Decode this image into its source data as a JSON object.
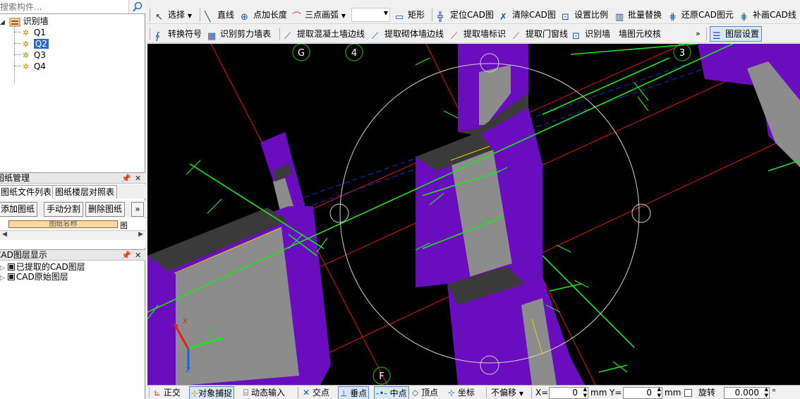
{
  "search": {
    "placeholder": "搜索构件..."
  },
  "tree": {
    "root": "识别墙",
    "items": [
      "Q1",
      "Q2",
      "Q3",
      "Q4"
    ],
    "selected": "Q2"
  },
  "drawing_panel": {
    "title": "图纸管理",
    "tabs": [
      "图纸文件列表",
      "图纸楼层对照表"
    ],
    "buttons": [
      "添加图纸",
      "手动分割",
      "删除图纸"
    ],
    "more": "»",
    "grid_header": "图纸名称",
    "grid_header2": "图"
  },
  "layer_panel": {
    "title": "CAD图层显示",
    "items": [
      "已提取的CAD图层",
      "CAD原始图层"
    ]
  },
  "toolbar1": {
    "select": "选择",
    "line": "直线",
    "point_length": "点加长度",
    "arc": "三点画弧",
    "rect": "矩形",
    "locate_cad": "定位CAD图",
    "clear_cad": "清除CAD图",
    "set_scale": "设置比例",
    "batch_replace": "批量替换",
    "restore_cad": "还原CAD图元",
    "fill_cad": "补画CAD线"
  },
  "toolbar2": {
    "convert_symbol": "转换符号",
    "shear_wall_table": "识别剪力墙表",
    "extract_concrete_edge": "提取混凝土墙边线",
    "extract_masonry_edge": "提取砌体墙边线",
    "extract_wall_mark": "提取墙标识",
    "extract_door_window_line": "提取门窗线",
    "identify_wall": "识别墙",
    "wall_check": "墙图元校核",
    "more": "»",
    "layer_settings": "图层设置"
  },
  "axis_labels": [
    "G",
    "4",
    "3",
    "F"
  ],
  "ucs": {
    "x": "X",
    "y": "Y",
    "z": "Z"
  },
  "status": {
    "ortho": "正交",
    "object_snap": "对象捕捉",
    "dynamic_input": "动态输入",
    "intersection": "交点",
    "perpendicular": "垂点",
    "midpoint": "中点",
    "vertex": "顶点",
    "coordinate": "坐标",
    "offset_mode": "不偏移",
    "x_label": "X=",
    "x_value": "0",
    "x_unit": "mm",
    "y_label": "Y=",
    "y_value": "0",
    "y_unit": "mm",
    "rotate_label": "旋转",
    "rotate_value": "0.000",
    "rotate_unit": "°"
  },
  "colors": {
    "wall_purple": "#6a0dbf",
    "wall_grey": "#8c8c8c",
    "grid_red": "#d81818",
    "dim_green": "#1ee41e",
    "axis_circle_green": "#1aa01a",
    "hidden_blue": "#2030c0",
    "selection_blue": "#316ac5"
  }
}
